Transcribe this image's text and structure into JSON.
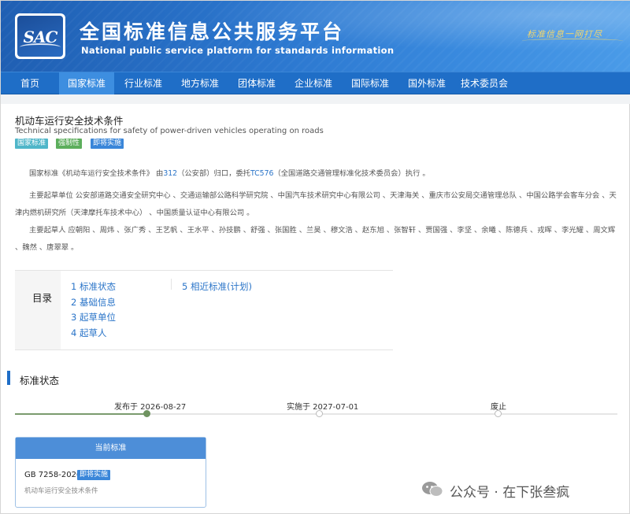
{
  "header": {
    "logo_text": "SAC",
    "title": "全国标准信息公共服务平台",
    "subtitle": "National public service platform  for standards information",
    "slogan": "标准信息一网打尽"
  },
  "nav": {
    "items": [
      {
        "label": "首页"
      },
      {
        "label": "国家标准"
      },
      {
        "label": "行业标准"
      },
      {
        "label": "地方标准"
      },
      {
        "label": "团体标准"
      },
      {
        "label": "企业标准"
      },
      {
        "label": "国际标准"
      },
      {
        "label": "国外标准"
      },
      {
        "label": "技术委员会"
      }
    ],
    "active_index": 1
  },
  "standard": {
    "title": "机动车运行安全技术条件",
    "title_en": "Technical specifications for safety of power-driven vehicles operating on roads",
    "tags": [
      {
        "label": "国家标准",
        "color": "#4fb6c9"
      },
      {
        "label": "强制性",
        "color": "#5cae5c"
      },
      {
        "label": "即将实施",
        "color": "#3a86d9"
      }
    ],
    "intro": {
      "prefix": "国家标准《机动车运行安全技术条件》 由",
      "org_code": "312",
      "org_name": "（公安部）归口，委托",
      "tc_code": "TC576",
      "tc_name": "（全国道路交通管理标准化技术委员会）执行 。"
    },
    "drafting_units": "主要起草单位 公安部道路交通安全研究中心 、交通运输部公路科学研究院 、中国汽车技术研究中心有限公司 、天津海关 、重庆市公安局交通管理总队 、中国公路学会客车分会 、天津内燃机研究所（天津摩托车技术中心） 、中国质量认证中心有限公司 。",
    "drafters": "主要起草人 应朝阳 、周炜 、张广秀 、王艺帆 、王水平 、孙技鹏 、舒强 、张国胜 、兰昊 、穆文浩 、赵东旭 、张智轩 、贾国强 、李坚 、余曦 、陈德兵 、戎晖 、李光耀 、周文辉 、魏然 、唐翠翠 。"
  },
  "toc": {
    "title": "目录",
    "items": [
      {
        "label": "1  标准状态"
      },
      {
        "label": "2  基础信息"
      },
      {
        "label": "3  起草单位"
      },
      {
        "label": "4  起草人"
      },
      {
        "label": "5  相近标准(计划)"
      }
    ]
  },
  "status": {
    "section_title": "标准状态",
    "timeline": [
      {
        "label": "发布于 2026-08-27",
        "done": true
      },
      {
        "label": "实施于 2027-07-01",
        "done": false
      },
      {
        "label": "废止",
        "done": false
      }
    ],
    "progress_fraction": 0.22,
    "current_card": {
      "header": "当前标准",
      "code": "GB 7258-2026",
      "tag": "即将实施",
      "name": "机动车运行安全技术条件"
    }
  },
  "watermark": {
    "text": "公众号 · 在下张叁疯",
    "icon": "wechat-official-account-icon"
  }
}
